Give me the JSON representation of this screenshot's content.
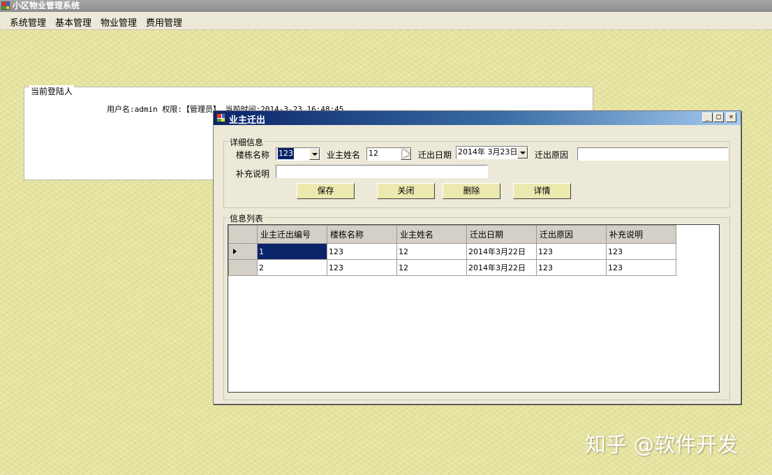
{
  "app": {
    "title": "小区物业管理系统"
  },
  "menu": [
    "系统管理",
    "基本管理",
    "物业管理",
    "费用管理"
  ],
  "login_panel": {
    "legend": "当前登陆人",
    "info": "用户名:admin 权限:【管理员】 当前时间:2014-3-23 16:48:45"
  },
  "dialog": {
    "title": "业主迁出",
    "caption_buttons": [
      "minimize-icon",
      "maximize-icon",
      "close-icon"
    ],
    "detail_group": {
      "legend": "详细信息",
      "building_label": "楼栋名称",
      "building_value": "123",
      "owner_label": "业主姓名",
      "owner_value": "12",
      "date_label": "迁出日期",
      "date_value": "2014年 3月23日",
      "reason_label": "迁出原因",
      "reason_value": "",
      "note_label": "补充说明",
      "note_value": ""
    },
    "buttons": {
      "save": "保存",
      "close": "关闭",
      "delete": "删除",
      "details": "详情"
    },
    "list_group": {
      "legend": "信息列表",
      "columns": [
        "业主迁出编号",
        "楼栋名称",
        "业主姓名",
        "迁出日期",
        "迁出原因",
        "补充说明"
      ],
      "rows": [
        [
          "1",
          "123",
          "12",
          "2014年3月22日",
          "123",
          "123"
        ],
        [
          "2",
          "123",
          "12",
          "2014年3月22日",
          "123",
          "123"
        ]
      ]
    }
  },
  "watermark": "知乎 @软件开发"
}
